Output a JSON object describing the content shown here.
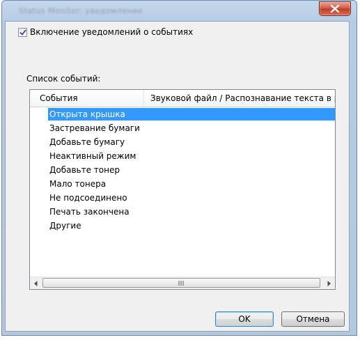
{
  "window": {
    "title": "Status Monitor: уведомление"
  },
  "notifications": {
    "checkbox_label": "Включение уведомлений о событиях",
    "checked": true
  },
  "events": {
    "section_label": "Список событий:",
    "columns": [
      "События",
      "Звуковой файл / Распознавание текста в р"
    ],
    "items": [
      "Открыта крышка",
      "Застревание бумаги",
      "Добавьте бумагу",
      "Неактивный режим",
      "Добавьте тонер",
      "Мало тонера",
      "Не подсоединено",
      "Печать закончена",
      "Другие"
    ],
    "selected_index": 0,
    "scroll_grip": "III"
  },
  "buttons": {
    "ok": "OK",
    "cancel": "Отмена"
  },
  "colors": {
    "selection": "#3399ff",
    "close_button": "#c9452f"
  },
  "icons": {
    "close": "close-icon",
    "check": "checkmark-icon",
    "scroll_left": "arrow-left-icon",
    "scroll_right": "arrow-right-icon"
  }
}
